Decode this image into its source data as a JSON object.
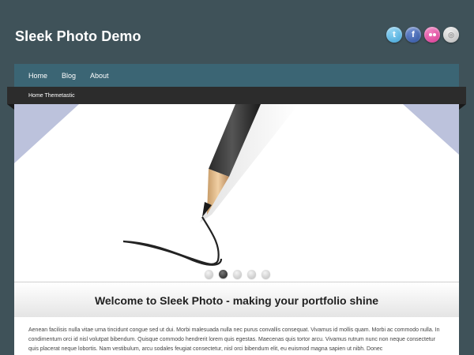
{
  "site": {
    "title": "Sleek Photo Demo"
  },
  "social": [
    {
      "name": "twitter",
      "glyph": "t",
      "color": "#3a9fd4"
    },
    {
      "name": "facebook",
      "glyph": "f",
      "color": "#2c4f9a"
    },
    {
      "name": "flickr",
      "glyph": "",
      "color": "#d6338f"
    },
    {
      "name": "rss",
      "glyph": "◎",
      "color": "#b5b5b5"
    }
  ],
  "nav": {
    "items": [
      "Home",
      "Blog",
      "About"
    ]
  },
  "subnav": {
    "label": "Home Themetastic"
  },
  "slider": {
    "dot_count": 5,
    "active_index": 1
  },
  "welcome": {
    "heading": "Welcome to Sleek Photo - making your portfolio shine"
  },
  "content": {
    "text": "Aenean facilisis nulla vitae urna tincidunt congue sed ut dui. Morbi malesuada nulla nec purus convallis consequat. Vivamus id mollis quam. Morbi ac commodo nulla. In condimentum orci id nisl volutpat bibendum. Quisque commodo hendrerit lorem quis egestas. Maecenas quis tortor arcu. Vivamus rutrum nunc non neque consectetur quis placerat neque lobortis. Nam vestibulum, arcu sodales feugiat consectetur, nisl orci bibendum elit, eu euismod magna sapien ut nibh. Donec"
  }
}
